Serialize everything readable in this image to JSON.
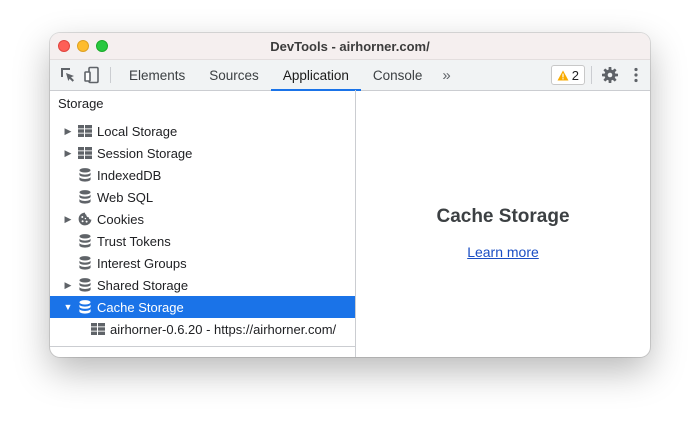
{
  "window": {
    "title": "DevTools - airhorner.com/"
  },
  "toolbar": {
    "tabs": [
      {
        "label": "Elements"
      },
      {
        "label": "Sources"
      },
      {
        "label": "Application"
      },
      {
        "label": "Console"
      }
    ],
    "more_tabs_label": "»",
    "warnings_count": "2"
  },
  "sidebar": {
    "header": "Storage",
    "items": [
      {
        "label": "Local Storage",
        "icon": "grid-icon",
        "expandable": true
      },
      {
        "label": "Session Storage",
        "icon": "grid-icon",
        "expandable": true
      },
      {
        "label": "IndexedDB",
        "icon": "database-icon",
        "expandable": false
      },
      {
        "label": "Web SQL",
        "icon": "database-icon",
        "expandable": false
      },
      {
        "label": "Cookies",
        "icon": "cookie-icon",
        "expandable": true
      },
      {
        "label": "Trust Tokens",
        "icon": "database-icon",
        "expandable": false
      },
      {
        "label": "Interest Groups",
        "icon": "database-icon",
        "expandable": false
      },
      {
        "label": "Shared Storage",
        "icon": "database-icon",
        "expandable": true
      },
      {
        "label": "Cache Storage",
        "icon": "database-icon",
        "expandable": true,
        "expanded": true,
        "selected": true
      }
    ],
    "cache_child": {
      "label": "airhorner-0.6.20 - https://airhorner.com/",
      "icon": "grid-icon"
    }
  },
  "main": {
    "title": "Cache Storage",
    "link": "Learn more"
  },
  "colors": {
    "accent": "#1a73e8",
    "warning": "#f9ab00",
    "link": "#1a4ec4"
  }
}
